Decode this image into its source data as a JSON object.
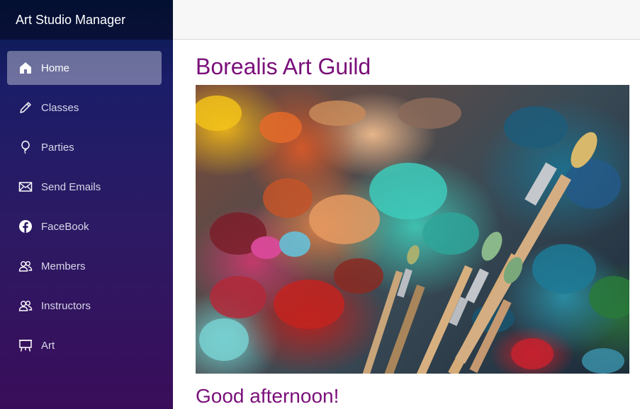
{
  "app": {
    "title": "Art Studio Manager"
  },
  "sidebar": {
    "items": [
      {
        "label": "Home",
        "icon": "home-icon",
        "active": true
      },
      {
        "label": "Classes",
        "icon": "pencil-icon",
        "active": false
      },
      {
        "label": "Parties",
        "icon": "balloon-icon",
        "active": false
      },
      {
        "label": "Send Emails",
        "icon": "envelope-icon",
        "active": false
      },
      {
        "label": "FaceBook",
        "icon": "facebook-icon",
        "active": false
      },
      {
        "label": "Members",
        "icon": "people-icon",
        "active": false
      },
      {
        "label": "Instructors",
        "icon": "people-icon",
        "active": false
      },
      {
        "label": "Art",
        "icon": "easel-icon",
        "active": false
      }
    ]
  },
  "main": {
    "title": "Borealis Art Guild",
    "greeting": "Good afternoon!",
    "hero_image": "paint-palette-with-brushes"
  },
  "colors": {
    "accent_text": "#7a0f7a",
    "sidebar_top": "#061a4f",
    "sidebar_bottom": "#3a0d5a",
    "topbar": "#f7f7f7"
  }
}
